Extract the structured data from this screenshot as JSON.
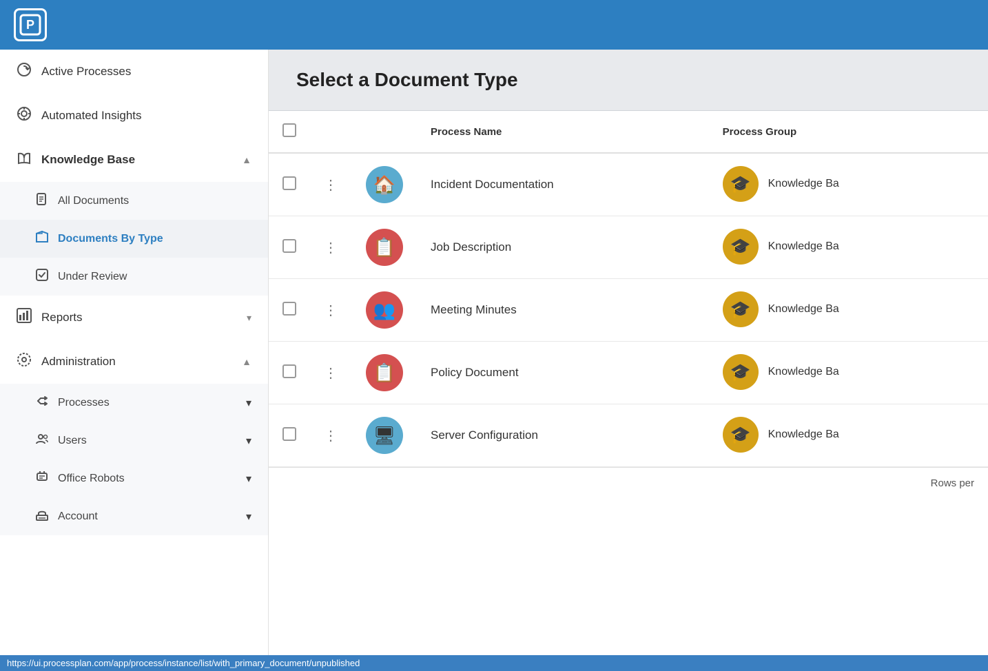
{
  "header": {
    "logo_text": "P"
  },
  "sidebar": {
    "items": [
      {
        "id": "active-processes",
        "label": "Active Processes",
        "icon": "⟳",
        "chevron": "",
        "expanded": false,
        "bold": false
      },
      {
        "id": "automated-insights",
        "label": "Automated Insights",
        "icon": "◎",
        "chevron": "",
        "expanded": false,
        "bold": false
      },
      {
        "id": "knowledge-base",
        "label": "Knowledge Base",
        "icon": "📚",
        "chevron": "▲",
        "expanded": true,
        "bold": true
      },
      {
        "id": "reports",
        "label": "Reports",
        "icon": "📊",
        "chevron": "▾",
        "expanded": false,
        "bold": false
      },
      {
        "id": "administration",
        "label": "Administration",
        "icon": "⚙",
        "chevron": "▲",
        "expanded": true,
        "bold": false
      },
      {
        "id": "processes",
        "label": "Processes",
        "icon": "↔",
        "chevron": "▾",
        "expanded": false,
        "bold": false,
        "sub": true
      },
      {
        "id": "users",
        "label": "Users",
        "icon": "👥",
        "chevron": "▾",
        "expanded": false,
        "bold": false,
        "sub": true
      },
      {
        "id": "office-robots",
        "label": "Office Robots",
        "icon": "🖥",
        "chevron": "▾",
        "expanded": false,
        "bold": false,
        "sub": true
      },
      {
        "id": "account",
        "label": "Account",
        "icon": "🏛",
        "chevron": "▾",
        "expanded": false,
        "bold": false,
        "sub": true
      }
    ],
    "sub_items": [
      {
        "id": "all-documents",
        "label": "All Documents",
        "icon": "📄"
      },
      {
        "id": "documents-by-type",
        "label": "Documents By Type",
        "icon": "📁",
        "active": true
      },
      {
        "id": "under-review",
        "label": "Under Review",
        "icon": "✓"
      }
    ]
  },
  "main": {
    "page_title": "Select a Document Type",
    "table": {
      "columns": [
        "",
        "",
        "",
        "Process Name",
        "Process Group"
      ],
      "rows": [
        {
          "id": "row-1",
          "process_name": "Incident Documentation",
          "process_icon_color": "#5aabcf",
          "process_icon": "🏠",
          "group_icon": "🎓",
          "group_label": "Knowledge Ba"
        },
        {
          "id": "row-2",
          "process_name": "Job Description",
          "process_icon_color": "#d45050",
          "process_icon": "📋",
          "group_icon": "🎓",
          "group_label": "Knowledge Ba"
        },
        {
          "id": "row-3",
          "process_name": "Meeting Minutes",
          "process_icon_color": "#d45050",
          "process_icon": "👥",
          "group_icon": "🎓",
          "group_label": "Knowledge Ba"
        },
        {
          "id": "row-4",
          "process_name": "Policy Document",
          "process_icon_color": "#d45050",
          "process_icon": "📋",
          "group_icon": "🎓",
          "group_label": "Knowledge Ba"
        },
        {
          "id": "row-5",
          "process_name": "Server Configuration",
          "process_icon_color": "#5aabcf",
          "process_icon": "🖥",
          "group_icon": "🎓",
          "group_label": "Knowledge Ba"
        }
      ]
    },
    "footer": {
      "rows_per_label": "Rows per"
    }
  },
  "status_bar": {
    "url": "https://ui.processplan.com/app/process/instance/list/with_primary_document/unpublished"
  }
}
